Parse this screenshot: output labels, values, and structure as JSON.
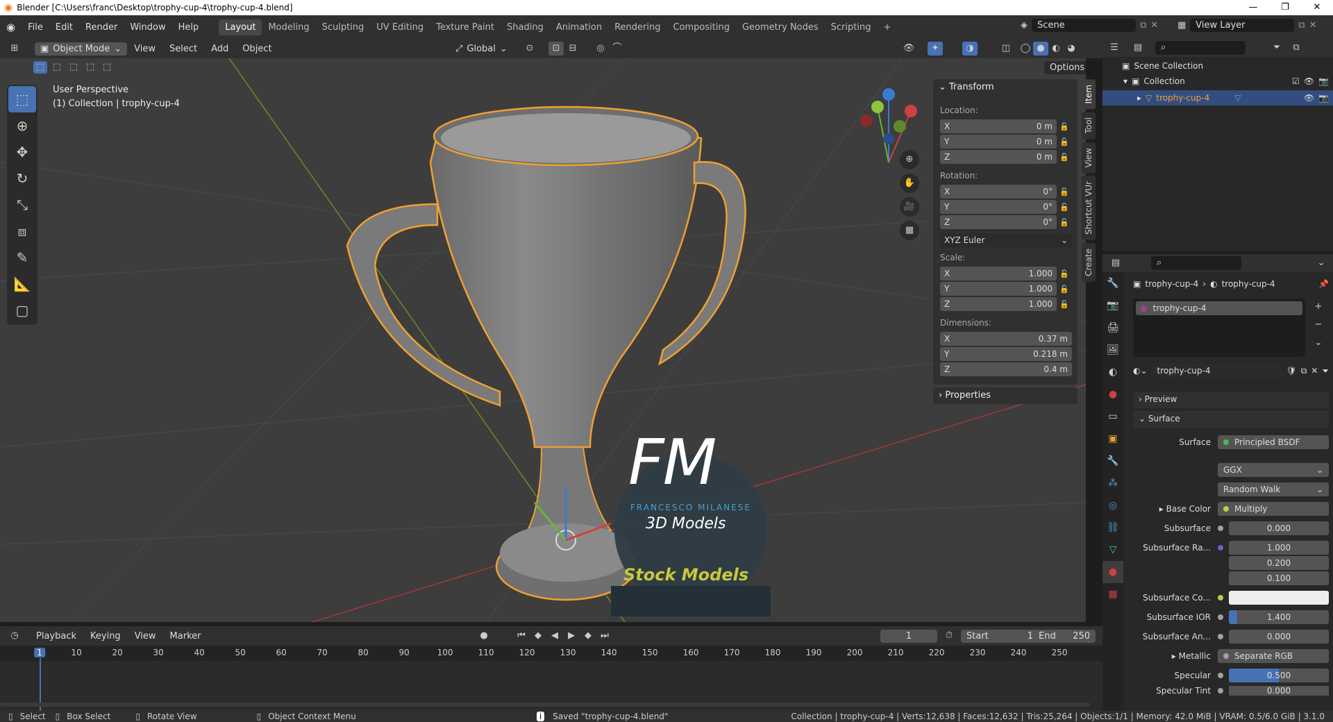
{
  "window": {
    "title": "Blender [C:\\Users\\franc\\Desktop\\trophy-cup-4\\trophy-cup-4.blend]"
  },
  "menu": [
    "File",
    "Edit",
    "Render",
    "Window",
    "Help"
  ],
  "workspaces": [
    "Layout",
    "Modeling",
    "Sculpting",
    "UV Editing",
    "Texture Paint",
    "Shading",
    "Animation",
    "Rendering",
    "Compositing",
    "Geometry Nodes",
    "Scripting"
  ],
  "scene": {
    "scene_name": "Scene",
    "view_layer": "View Layer"
  },
  "viewport_header": {
    "mode": "Object Mode",
    "menus": [
      "View",
      "Select",
      "Add",
      "Object"
    ],
    "orientation": "Global",
    "options": "Options"
  },
  "viewport": {
    "perspective": "User Perspective",
    "collection_info": "(1) Collection | trophy-cup-4"
  },
  "transform": {
    "title": "Transform",
    "location_label": "Location:",
    "location": {
      "x": "0 m",
      "y": "0 m",
      "z": "0 m"
    },
    "rotation_label": "Rotation:",
    "rotation": {
      "x": "0°",
      "y": "0°",
      "z": "0°"
    },
    "rotation_mode": "XYZ Euler",
    "scale_label": "Scale:",
    "scale": {
      "x": "1.000",
      "y": "1.000",
      "z": "1.000"
    },
    "dimensions_label": "Dimensions:",
    "dimensions": {
      "x": "0.37 m",
      "y": "0.218 m",
      "z": "0.4 m"
    },
    "axis": {
      "x": "X",
      "y": "Y",
      "z": "Z"
    },
    "properties": "Properties"
  },
  "sidebar_tabs": [
    "Item",
    "Tool",
    "View",
    "Shortcut VUr",
    "Create"
  ],
  "outliner": {
    "scene_collection": "Scene Collection",
    "collection": "Collection",
    "object": "trophy-cup-4"
  },
  "properties": {
    "breadcrumb_object": "trophy-cup-4",
    "breadcrumb_material": "trophy-cup-4",
    "slot": "trophy-cup-4",
    "material_name": "trophy-cup-4",
    "preview": "Preview",
    "surface_section": "Surface",
    "rows": [
      {
        "label": "Surface",
        "value": "Principled BSDF",
        "dot": "#3fbf4f"
      },
      {
        "label": "",
        "value": "GGX",
        "dot": ""
      },
      {
        "label": "",
        "value": "Random Walk",
        "dot": ""
      },
      {
        "label": "Base Color",
        "value": "Multiply",
        "dot": "#c7c74f"
      },
      {
        "label": "Subsurface",
        "value": "0.000",
        "dot": "#a1a1a1"
      },
      {
        "label": "Subsurface Ra...",
        "value": "1.000",
        "dot": "#6363c7"
      },
      {
        "label": "",
        "value": "0.200",
        "dot": ""
      },
      {
        "label": "",
        "value": "0.100",
        "dot": ""
      },
      {
        "label": "Subsurface Co...",
        "value": "",
        "dot": "#c7c74f"
      },
      {
        "label": "Subsurface IOR",
        "value": "1.400",
        "dot": "#a1a1a1"
      },
      {
        "label": "Subsurface An...",
        "value": "0.000",
        "dot": "#a1a1a1"
      },
      {
        "label": "Metallic",
        "value": "Separate RGB",
        "dot": "#a1a1a1"
      },
      {
        "label": "Specular",
        "value": "0.500",
        "dot": "#a1a1a1"
      },
      {
        "label": "Specular Tint",
        "value": "0.000",
        "dot": "#a1a1a1"
      }
    ]
  },
  "timeline": {
    "menus": [
      "Playback",
      "Keying",
      "View",
      "Marker"
    ],
    "current_frame": "1",
    "start_label": "Start",
    "start": "1",
    "end_label": "End",
    "end": "250",
    "ticks": [
      "1",
      "10",
      "20",
      "30",
      "40",
      "50",
      "60",
      "70",
      "80",
      "90",
      "100",
      "110",
      "120",
      "130",
      "140",
      "150",
      "160",
      "170",
      "180",
      "190",
      "200",
      "210",
      "220",
      "230",
      "240",
      "250"
    ]
  },
  "watermark": {
    "letters": "FM",
    "name": "FRANCESCO MILANESE",
    "sub": "3D Models",
    "banner": "Stock Models"
  },
  "status": {
    "select": "Select",
    "box_select": "Box Select",
    "rotate": "Rotate View",
    "context": "Object Context Menu",
    "saved": "Saved \"trophy-cup-4.blend\"",
    "stats": "Collection | trophy-cup-4 | Verts:12,638 | Faces:12,632 | Tris:25,264 | Objects:1/1 | Memory: 42.0 MiB | VRAM: 0.5/6.0 GiB | 3.1.0"
  },
  "colors": {
    "accent": "#4772b3",
    "selection": "#f0a030",
    "header": "#303030"
  }
}
